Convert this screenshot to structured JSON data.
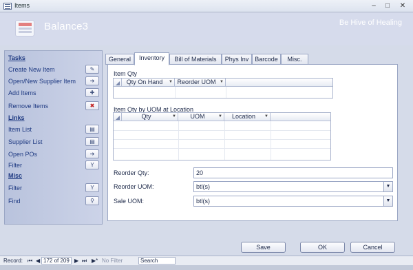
{
  "window": {
    "title": "Items",
    "minimize": "–",
    "maximize": "□",
    "close": "✕"
  },
  "header": {
    "form_title": "Balance3",
    "company": "Be Hive of Healing",
    "logo_icon": "form-icon"
  },
  "sidebar": {
    "tasks_heading": "Tasks",
    "tasks": [
      {
        "label": "Create New Item",
        "icon": "new-item-icon",
        "glyph": "✎"
      },
      {
        "label": "Open/New Supplier Item",
        "icon": "arrow-right-icon",
        "glyph": "➔"
      },
      {
        "label": "Add Items",
        "icon": "add-icon",
        "glyph": "✚"
      },
      {
        "label": "Remove Items",
        "icon": "remove-icon",
        "glyph": "✖"
      }
    ],
    "links_heading": "Links",
    "links": [
      {
        "label": "Item List",
        "icon": "list-icon",
        "glyph": "▤"
      },
      {
        "label": "Supplier List",
        "icon": "list-icon",
        "glyph": "▤"
      },
      {
        "label": "Open POs",
        "icon": "arrow-right-icon",
        "glyph": "➔"
      },
      {
        "label": "Filter",
        "icon": "filter-icon",
        "glyph": "Y"
      }
    ],
    "misc_heading": "Misc",
    "misc": [
      {
        "label": "Filter",
        "icon": "filter-icon",
        "glyph": "Y"
      },
      {
        "label": "Find",
        "icon": "binoculars-icon",
        "glyph": "⚲"
      }
    ]
  },
  "tabs": [
    "General",
    "Inventory",
    "Bill of Materials",
    "Phys Inv",
    "Barcode",
    "Misc."
  ],
  "active_tab": "Inventory",
  "item_qty": {
    "label": "Item Qty",
    "columns": [
      "Qty On Hand",
      "Reorder UOM"
    ]
  },
  "item_qty_uom": {
    "label": "Item Qty by UOM at Location",
    "columns": [
      "Qty",
      "UOM",
      "Location"
    ]
  },
  "fields": {
    "reorder_qty": {
      "label": "Reorder Qty:",
      "value": "20"
    },
    "reorder_uom": {
      "label": "Reorder UOM:",
      "value": "btl(s)"
    },
    "sale_uom": {
      "label": "Sale UOM:",
      "value": "btl(s)"
    }
  },
  "buttons": {
    "save": "Save",
    "ok": "OK",
    "cancel": "Cancel"
  },
  "status": {
    "record_label": "Record:",
    "first": "⏮",
    "prev": "◀",
    "record_position": "172 of 209",
    "next": "▶",
    "last": "⏭",
    "new": "▶*",
    "filter": "No Filter",
    "search": "Search"
  }
}
